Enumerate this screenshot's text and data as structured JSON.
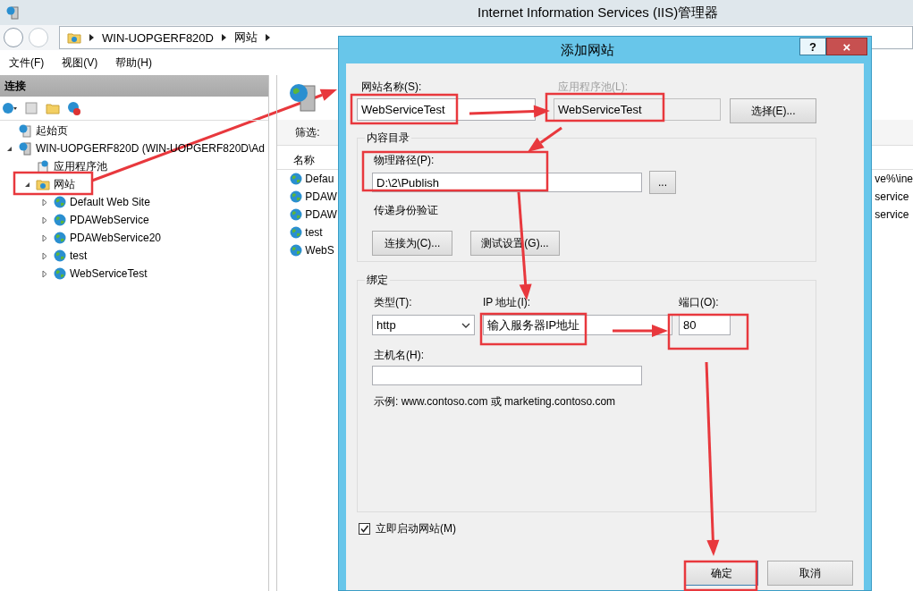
{
  "window": {
    "title": "Internet Information Services (IIS)管理器"
  },
  "address_bar": {
    "path": [
      "WIN-UOPGERF820D",
      "网站"
    ]
  },
  "menu": [
    "文件(F)",
    "视图(V)",
    "帮助(H)"
  ],
  "connections": {
    "title": "连接",
    "tree": [
      {
        "label": "起始页",
        "kind": "page"
      },
      {
        "label": "WIN-UOPGERF820D (WIN-UOPGERF820D\\Ad",
        "kind": "server",
        "expanded": true,
        "children": [
          {
            "label": "应用程序池",
            "kind": "pool"
          },
          {
            "label": "网站",
            "kind": "folder",
            "expanded": true,
            "children": [
              {
                "label": "Default Web Site",
                "kind": "site",
                "expanded": false
              },
              {
                "label": "PDAWebService",
                "kind": "site",
                "expanded": false
              },
              {
                "label": "PDAWebService20",
                "kind": "site",
                "expanded": false
              },
              {
                "label": "test",
                "kind": "site",
                "expanded": false
              },
              {
                "label": "WebServiceTest",
                "kind": "site",
                "expanded": false
              }
            ]
          }
        ]
      }
    ]
  },
  "content_pane": {
    "filter_label": "筛选:",
    "column_1": "名称",
    "rows": [
      {
        "name": "Defau",
        "column_2": "ve%\\ine"
      },
      {
        "name": "PDAW",
        "column_2": "service"
      },
      {
        "name": "PDAW",
        "column_2": "service"
      },
      {
        "name": "test"
      },
      {
        "name": "WebS"
      }
    ]
  },
  "dialog": {
    "title": "添加网站",
    "help_button": "?",
    "close_button": "×",
    "site_name": {
      "label": "网站名称(S):",
      "value": "WebServiceTest"
    },
    "app_pool": {
      "label": "应用程序池(L):",
      "value": "WebServiceTest",
      "disabled": true
    },
    "select_button": "选择(E)...",
    "content_group": {
      "title": "内容目录",
      "path_label": "物理路径(P):",
      "path_value": "D:\\2\\Publish",
      "browse_button": "...",
      "auth_label": "传递身份验证",
      "buttons": [
        "连接为(C)...",
        "测试设置(G)..."
      ]
    },
    "binding_group": {
      "title": "绑定",
      "type_label": "类型(T):",
      "type_value": "http",
      "ip_label": "IP 地址(I):",
      "ip_value": "输入服务器IP地址",
      "port_label": "端口(O):",
      "port_value": "80",
      "host_label": "主机名(H):",
      "example": "示例: www.contoso.com 或 marketing.contoso.com"
    },
    "start_now": {
      "label": "立即启动网站(M)",
      "checked": true
    },
    "buttons": [
      "确定",
      "取消"
    ]
  }
}
